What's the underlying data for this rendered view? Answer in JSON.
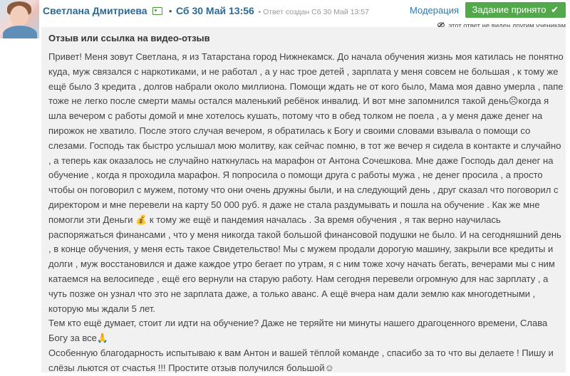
{
  "header": {
    "author": "Светлана Дмитриева",
    "id_icon": "id-card-icon",
    "separator": "•",
    "date": "Сб 30 Май 13:56",
    "created": "• Ответ создан Сб 30 Май 13:57",
    "moderation": "Модерация",
    "accept_label": "Задание принято",
    "accept_check": "✔",
    "hidden_note": "этот ответ не виден другим ученикам"
  },
  "review": {
    "title": "Отзыв или ссылка на видео-отзыв",
    "paragraphs": [
      "Привет! Меня зовут Светлана, я из Татарстана город Нижнекамск. До начала обучения жизнь моя катилась не понятно куда, муж связался с наркотиками, и не работал , а у нас трое детей , зарплата у меня совсем не большая , к тому же ещё было 3 кредита , долгов набрали около миллиона. Помощи ждать не от кого было, Мама моя давно умерла , папе тоже не легко после смерти мамы остался маленький ребёнок инвалид. И вот мне запомнился такой день☹когда я шла вечером с работы домой и мне хотелось кушать, потому что в обед толком не поела , а у меня даже денег на пирожок не хватило. После этого случая вечером, я обратилась к Богу и своими словами взывала о помощи со слезами. Господь так быстро услышал мою молитву, как сейчас помню, в тот же вечер я сидела в контакте и случайно , а теперь как оказалось не случайно наткнулась на марафон от Антона Сочешкова. Мне даже Господь дал денег на обучение , когда я проходила марафон. Я попросила о помощи друга с работы мужа , не денег просила , а просто чтобы он поговорил с мужем, потому что они очень дружны были, и на следующий день , друг сказал что поговорил с директором и мне перевели на карту 50 000 руб. я даже не стала раздумывать и пошла на обучение . Как же мне помогли эти Деньги 💰 к тому же ещё и пандемия началась . За время обучения , я так верно научилась распоряжаться финансами , что у меня никогда такой большой финансовой подушки не было. И на сегодняшний день , в конце обучения, у меня есть такое Свидетельство! Мы с мужем продали дорогую машину, закрыли все кредиты и долги , муж восстановился и даже каждое утро бегает по утрам, я с ним тоже хочу начать бегать, вечерами мы с ним катаемся на велосипеде , ещё его вернули на старую работу. Нам сегодня перевели огромную для нас зарплату , а чуть позже он узнал что это не зарплата даже, а только аванс. А ещё вчера нам дали землю как многодетными , которую мы ждали 5 лет.",
      "Тем кто ещё думает, стоит ли идти на обучение? Даже не теряйте ни минуты нашего драгоценного времени, Слава Богу за все🙏",
      "Особенную благодарность испытываю к вам Антон и вашей тёплой команде , спасибо за то что вы делаете ! Пишу и слёзы льются от счастья !!! Простите отзыв получился большой☺"
    ]
  }
}
